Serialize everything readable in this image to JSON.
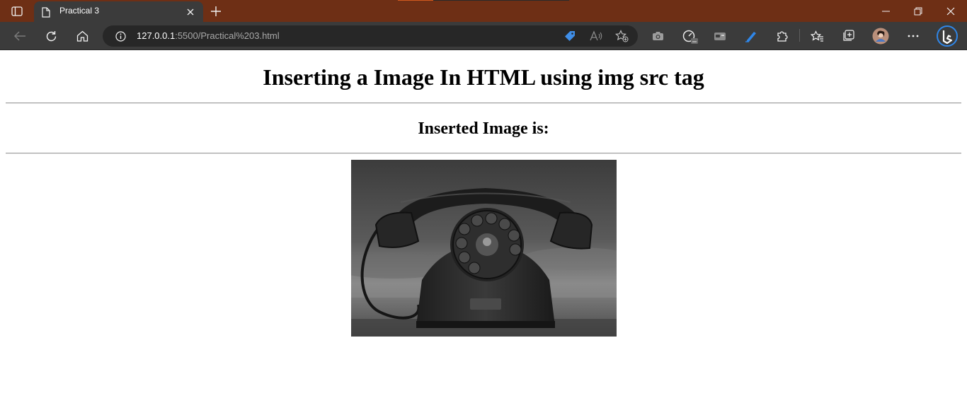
{
  "browser": {
    "tab": {
      "title": "Practical 3",
      "close_icon": "close-icon"
    },
    "new_tab_icon": "plus-icon",
    "address_bar": {
      "host": "127.0.0.1",
      "path": ":5500/Practical%203.html"
    },
    "colors": {
      "titlebar": "#6e2f15",
      "toolbar": "#3b3b3b",
      "address_field": "#272727"
    }
  },
  "page": {
    "heading": "Inserting a Image In HTML using img src tag",
    "subheading": "Inserted Image is:",
    "image": {
      "subject": "black rotary telephone",
      "name": "telephone-photo"
    }
  }
}
